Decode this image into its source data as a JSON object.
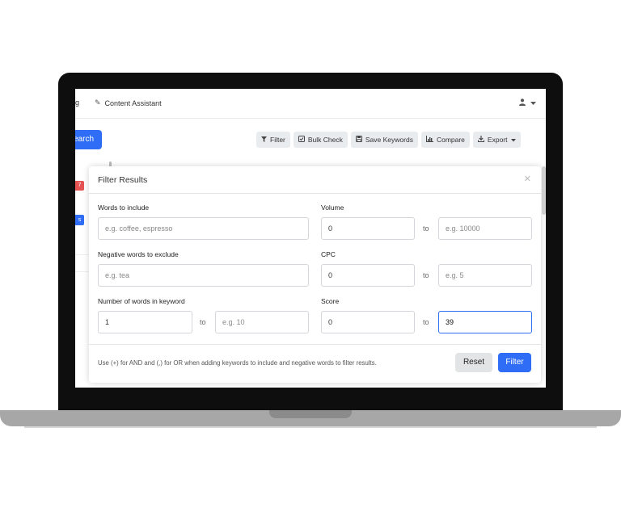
{
  "nav": {
    "truncated_item": "g",
    "content_assistant": "Content Assistant",
    "user_icon": "user-icon",
    "caret_icon": "caret-down-icon"
  },
  "toolbar": {
    "search_label": "earch",
    "filter_label": "Filter",
    "bulk_check_label": "Bulk Check",
    "save_keywords_label": "Save Keywords",
    "compare_label": "Compare",
    "export_label": "Export"
  },
  "background": {
    "red_badge": "7",
    "blue_badge": "s"
  },
  "modal": {
    "title": "Filter Results",
    "close_icon": "close-icon",
    "words_include": {
      "label": "Words to include",
      "placeholder": "e.g. coffee, espresso",
      "value": ""
    },
    "volume": {
      "label": "Volume",
      "from_value": "0",
      "to_placeholder": "e.g. 10000",
      "to_word": "to"
    },
    "negative_words": {
      "label": "Negative words to exclude",
      "placeholder": "e.g. tea",
      "value": ""
    },
    "cpc": {
      "label": "CPC",
      "from_value": "0",
      "to_placeholder": "e.g. 5",
      "to_word": "to"
    },
    "num_words": {
      "label": "Number of words in keyword",
      "from_value": "1",
      "to_placeholder": "e.g. 10",
      "to_word": "to"
    },
    "score": {
      "label": "Score",
      "from_value": "0",
      "to_value": "39",
      "to_word": "to"
    },
    "help_text": "Use (+) for AND and (,) for OR when adding keywords to include and negative words to filter results.",
    "reset_label": "Reset",
    "filter_label": "Filter"
  },
  "colors": {
    "primary": "#2f6df6",
    "danger": "#e55353",
    "button_gray": "#e9ecef"
  }
}
